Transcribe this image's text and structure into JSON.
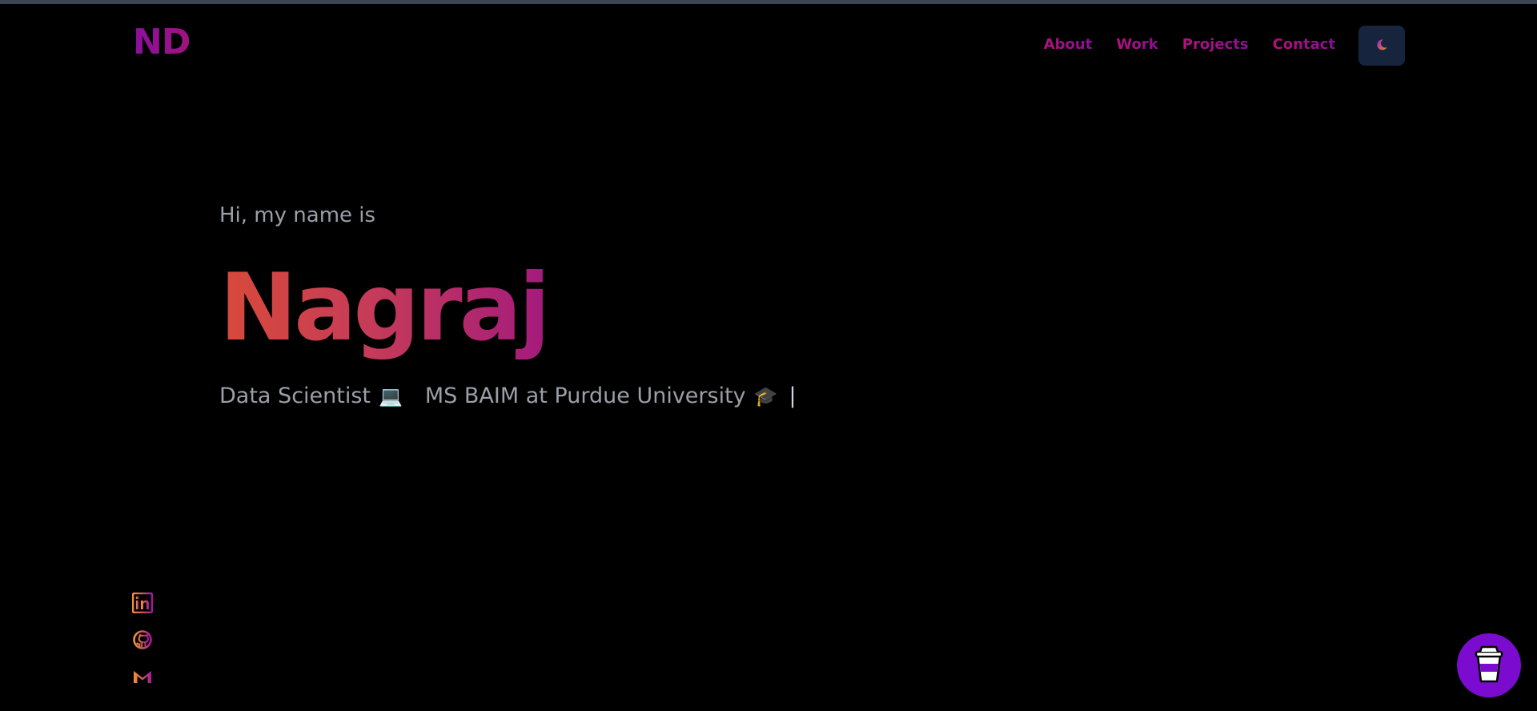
{
  "header": {
    "logo": "ND",
    "nav": [
      "About",
      "Work",
      "Projects",
      "Contact"
    ],
    "theme_toggle_icon": "moon-icon"
  },
  "hero": {
    "greeting": "Hi, my name is",
    "name": "Nagraj",
    "subtitle_part1": "Data Scientist",
    "subtitle_emoji1": "💻",
    "subtitle_part2": "MS BAIM at Purdue University",
    "subtitle_emoji2": "🎓",
    "cursor": "|"
  },
  "socials": [
    {
      "name": "linkedin",
      "icon": "linkedin-icon"
    },
    {
      "name": "github",
      "icon": "github-icon"
    },
    {
      "name": "gmail",
      "icon": "gmail-icon"
    }
  ],
  "coffee_button": {
    "icon": "coffee-cup-icon"
  },
  "colors": {
    "background": "#000000",
    "accent_purple": "#8b0fa0",
    "accent_magenta": "#b0127b",
    "name_gradient_start": "#d84a3a",
    "name_gradient_end": "#a41a7d",
    "muted_text": "#9a9fa8",
    "toggle_bg": "#16243d",
    "coffee_bg": "#7b0ccf"
  }
}
